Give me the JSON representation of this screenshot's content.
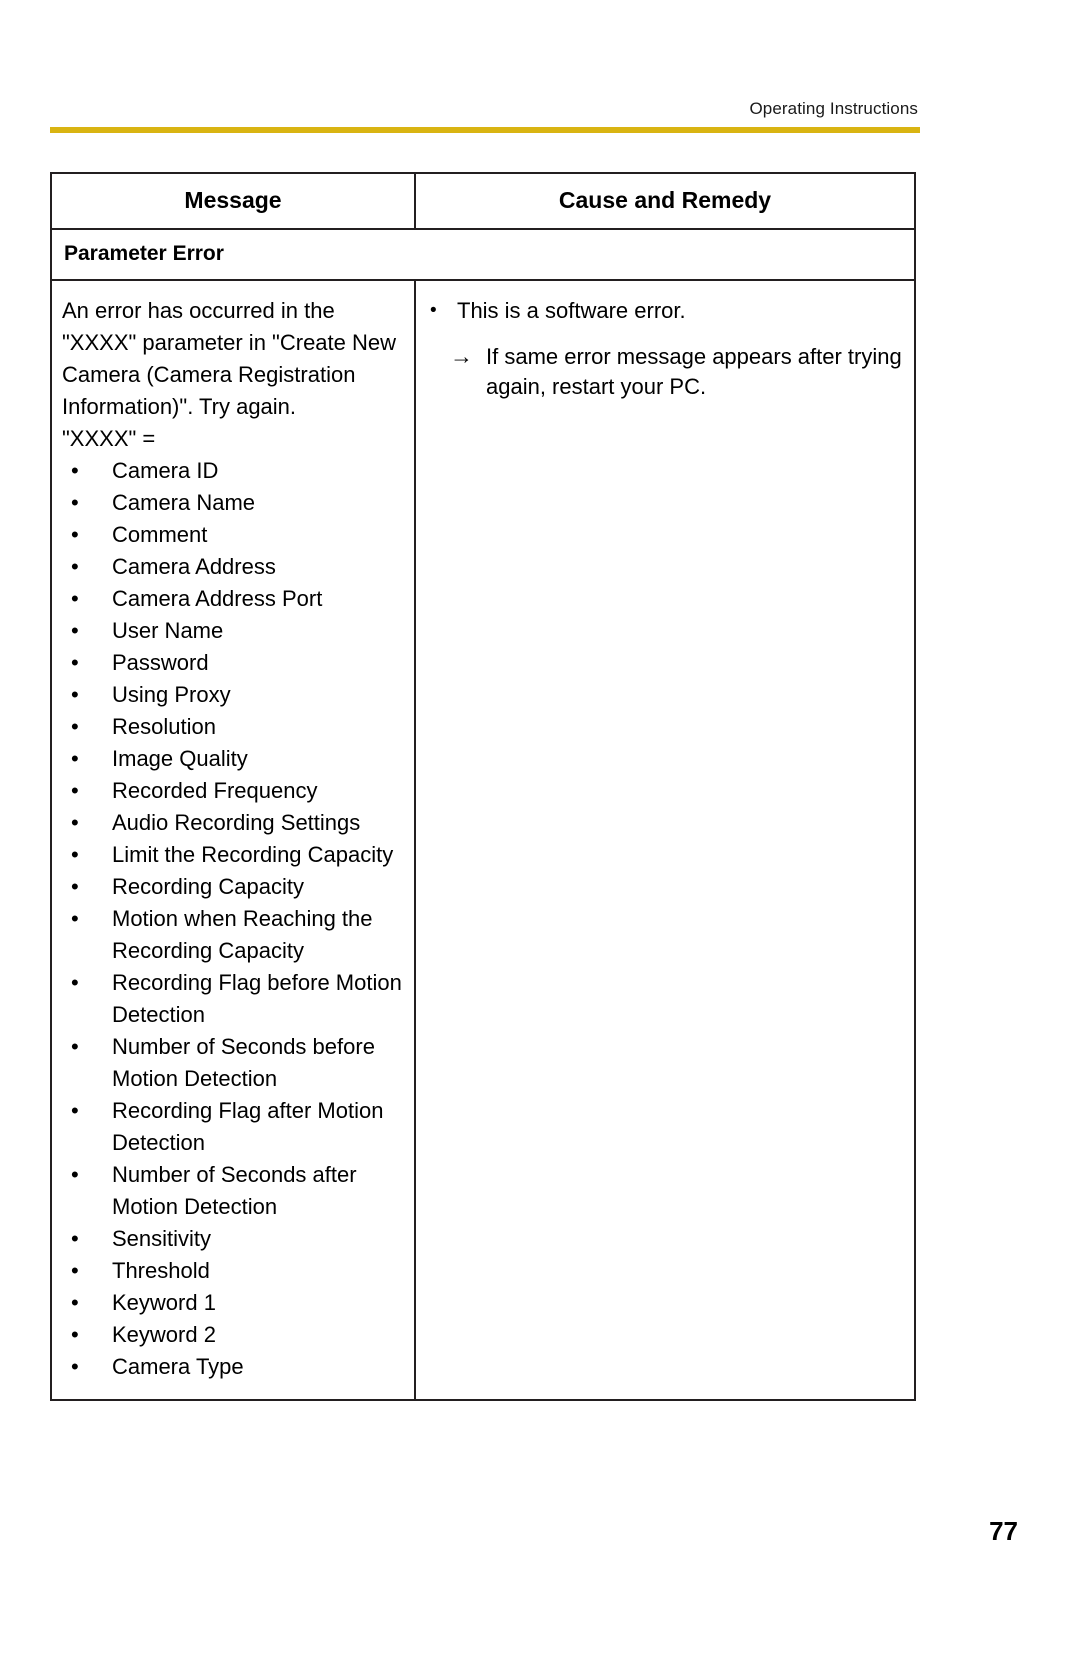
{
  "header": {
    "title": "Operating Instructions",
    "rule_color": "#d9b412"
  },
  "table": {
    "columns": [
      {
        "label": "Message"
      },
      {
        "label": "Cause and Remedy"
      }
    ],
    "section_title": "Parameter Error",
    "message": {
      "paragraph": "An error has occurred in the \"XXXX\" parameter in \"Create New Camera (Camera Registration Information)\". Try again.",
      "legend": "\"XXXX\" =",
      "bullet_marker": "•",
      "items": [
        "Camera ID",
        "Camera Name",
        "Comment",
        "Camera Address",
        "Camera Address Port",
        "User Name",
        "Password",
        "Using Proxy",
        "Resolution",
        "Image Quality",
        "Recorded Frequency",
        "Audio Recording Settings",
        "Limit the Recording Capacity",
        "Recording Capacity",
        "Motion when Reaching the Recording Capacity",
        "Recording Flag before Motion Detection",
        "Number of Seconds before Motion Detection",
        "Recording Flag after Motion Detection",
        "Number of Seconds after Motion Detection",
        "Sensitivity",
        "Threshold",
        "Keyword 1",
        "Keyword 2",
        "Camera Type"
      ]
    },
    "cause_and_remedy": {
      "bullet_marker": "•",
      "bullet_text": "This is a software error.",
      "arrow_marker": "→",
      "arrow_text": "If same error message appears after trying again, restart your PC."
    }
  },
  "footer": {
    "page_number": "77"
  }
}
